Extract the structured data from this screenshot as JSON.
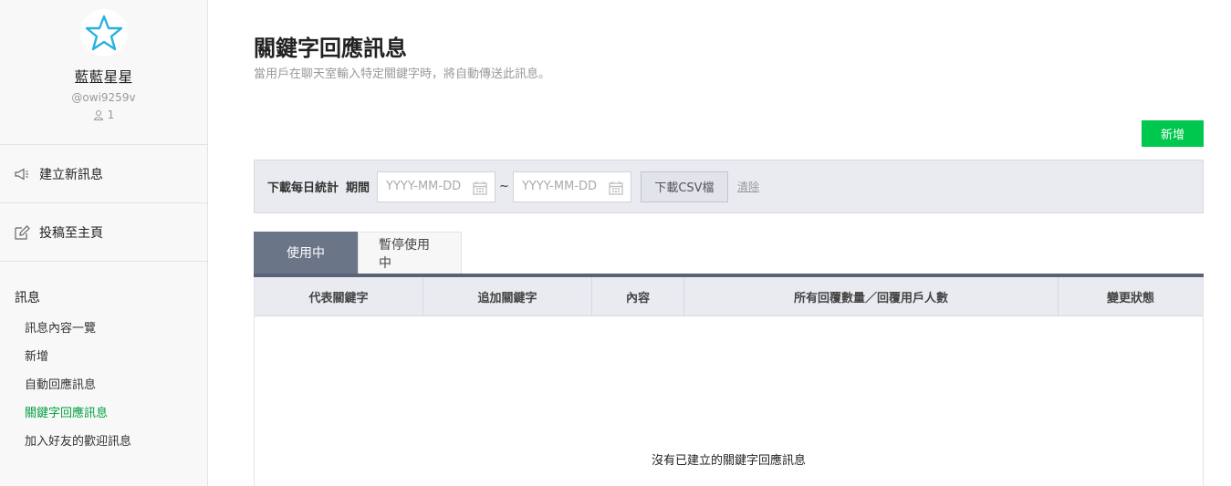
{
  "profile": {
    "name": "藍藍星星",
    "id": "@owi9259v",
    "friends": "1"
  },
  "sidebar": {
    "actions": [
      {
        "label": "建立新訊息",
        "icon": "megaphone-icon"
      },
      {
        "label": "投稿至主頁",
        "icon": "edit-icon"
      }
    ],
    "section_title": "訊息",
    "items": [
      {
        "label": "訊息內容一覽"
      },
      {
        "label": "新增"
      },
      {
        "label": "自動回應訊息"
      },
      {
        "label": "關鍵字回應訊息"
      },
      {
        "label": "加入好友的歡迎訊息"
      }
    ],
    "active_color": "#00a040"
  },
  "main": {
    "title": "關鍵字回應訊息",
    "description": "當用戶在聊天室輸入特定關鍵字時，將自動傳送此訊息。",
    "add_button": "新增",
    "filter": {
      "label_stats": "下載每日統計",
      "label_period": "期間",
      "start_placeholder": "YYYY-MM-DD",
      "end_placeholder": "YYYY-MM-DD",
      "separator": "~",
      "csv_button": "下載CSV檔",
      "clear_link": "清除"
    },
    "tabs": [
      {
        "label": "使用中"
      },
      {
        "label": "暫停使用中"
      }
    ],
    "table": {
      "columns": [
        "代表關鍵字",
        "追加關鍵字",
        "內容",
        "所有回覆數量／回覆用戶人數",
        "變更狀態"
      ]
    },
    "empty_message": "沒有已建立的關鍵字回應訊息"
  },
  "colors": {
    "brand_green": "#00c74d",
    "tab_active": "#6b7588"
  }
}
